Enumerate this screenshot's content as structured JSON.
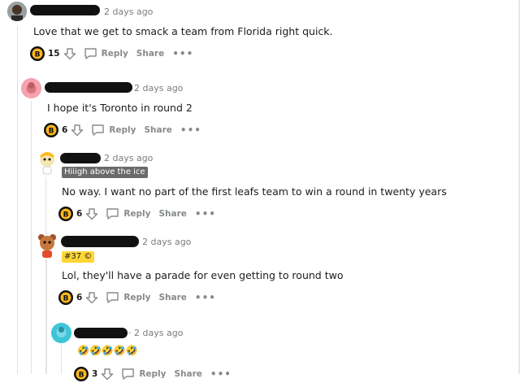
{
  "comments": [
    {
      "time": "2 days ago",
      "body": "Love that we get to smack a team from Florida right quick.",
      "score": "15",
      "reply_label": "Reply",
      "share_label": "Share",
      "more": "•••"
    },
    {
      "time": "2 days ago",
      "body": "I hope it's Toronto in round 2",
      "score": "6",
      "reply_label": "Reply",
      "share_label": "Share",
      "more": "•••"
    },
    {
      "time": "2 days ago",
      "flair": "Hiiigh above the ice",
      "body": "No way. I want no part of the first leafs team to win a round in twenty years",
      "score": "6",
      "reply_label": "Reply",
      "share_label": "Share",
      "more": "•••"
    },
    {
      "time": "2 days ago",
      "flair": "#37 ©",
      "body": "Lol, they'll have a parade for even getting to round two",
      "score": "6",
      "reply_label": "Reply",
      "share_label": "Share",
      "more": "•••"
    },
    {
      "time": "· 2 days ago",
      "body": "🤣🤣🤣🤣🤣",
      "score": "3",
      "reply_label": "Reply",
      "share_label": "Share",
      "more": "•••"
    }
  ],
  "colors": {
    "accent_red": "#f5a3ad",
    "bruins_gold": "#ffb81c",
    "flair_yellow": "#ffd635",
    "avatar_teal": "#3ec6d8"
  }
}
